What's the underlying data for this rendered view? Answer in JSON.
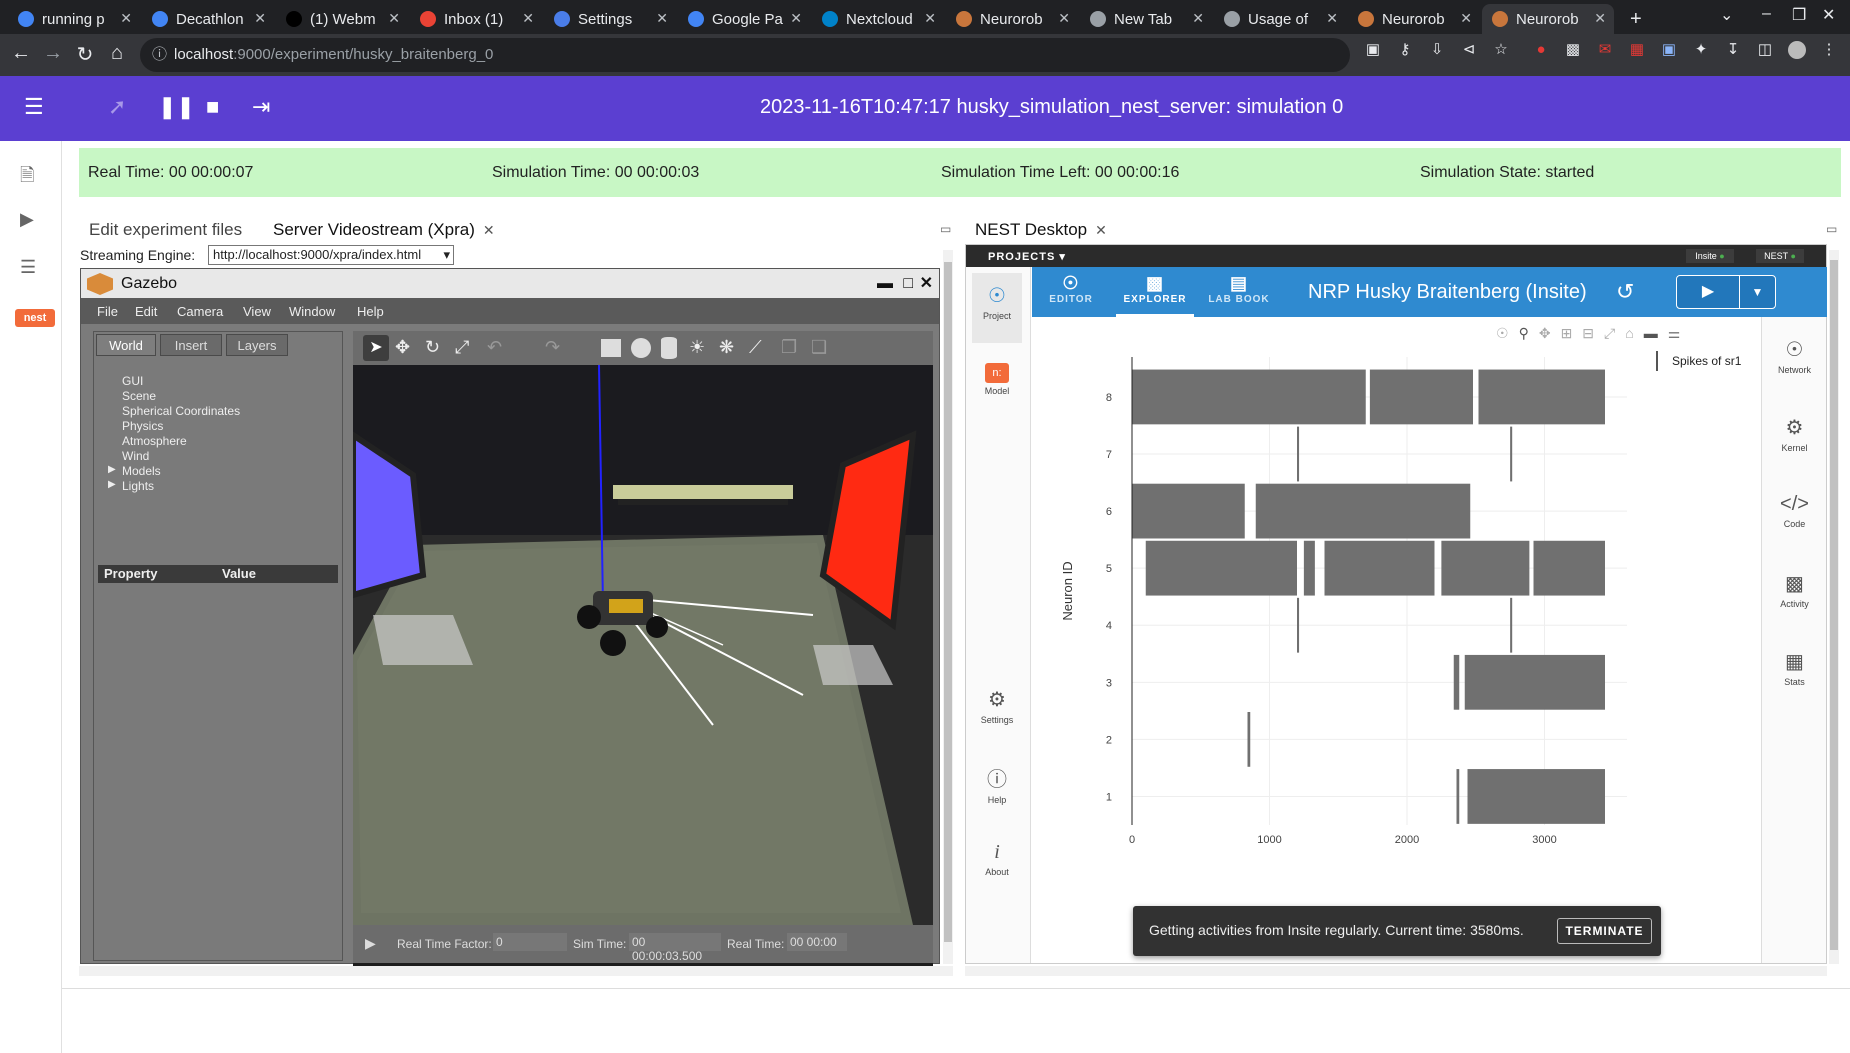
{
  "browser": {
    "tabs": [
      {
        "title": "running p",
        "color": "#4285f4"
      },
      {
        "title": "Decathlon",
        "color": "#4285f4"
      },
      {
        "title": "(1) Webm",
        "color": "#000000"
      },
      {
        "title": "Inbox (1)",
        "color": "#ea4335"
      },
      {
        "title": "Settings",
        "color": "#4a7de8"
      },
      {
        "title": "Google Pa",
        "color": "#4285f4"
      },
      {
        "title": "Nextcloud",
        "color": "#0082c9"
      },
      {
        "title": "Neurorob",
        "color": "#c8763c"
      },
      {
        "title": "New Tab",
        "color": "#9aa0a6"
      },
      {
        "title": "Usage of",
        "color": "#9aa0a6"
      },
      {
        "title": "Neurorob",
        "color": "#c8763c"
      },
      {
        "title": "Neurorob",
        "color": "#c8763c"
      }
    ],
    "url_host": "localhost",
    "url_rest": ":9000/experiment/husky_braitenberg_0"
  },
  "header": {
    "title": "2023-11-16T10:47:17 husky_simulation_nest_server: simulation 0"
  },
  "status": {
    "real_time": "Real Time: 00 00:00:07",
    "sim_time": "Simulation Time: 00 00:00:03",
    "time_left": "Simulation Time Left: 00 00:00:16",
    "state": "Simulation State: started"
  },
  "left_tabs": {
    "edit": "Edit experiment files",
    "stream": "Server Videostream (Xpra)"
  },
  "streaming": {
    "label": "Streaming Engine:",
    "value": "http://localhost:9000/xpra/index.html"
  },
  "gazebo": {
    "title": "Gazebo",
    "menu": [
      "File",
      "Edit",
      "Camera",
      "View",
      "Window",
      "Help"
    ],
    "panel_tabs": [
      "World",
      "Insert",
      "Layers"
    ],
    "tree": [
      "GUI",
      "Scene",
      "Spherical Coordinates",
      "Physics",
      "Atmosphere",
      "Wind",
      "Models",
      "Lights"
    ],
    "prop_header": "Property",
    "value_header": "Value",
    "rtf_label": "Real Time Factor:",
    "rtf_value": "0",
    "simtime_label": "Sim Time:",
    "simtime_value": "00 00:00:03.500",
    "realtime_label": "Real Time:",
    "realtime_value": "00 00:00"
  },
  "nest": {
    "tab": "NEST Desktop",
    "projects": "PROJECTS",
    "badge_insite": "Insite",
    "badge_nest": "NEST",
    "title": "NRP Husky Braitenberg (Insite)",
    "nav": [
      "EDITOR",
      "EXPLORER",
      "LAB BOOK"
    ],
    "side": [
      "Project",
      "Model",
      "Settings",
      "Help",
      "About"
    ],
    "right": [
      "Network",
      "Kernel",
      "Code",
      "Activity",
      "Stats"
    ],
    "toast": "Getting activities from Insite regularly. Current time: 3580ms.",
    "terminate": "TERMINATE"
  },
  "chart_data": {
    "type": "scatter",
    "title": "",
    "xlabel": "",
    "ylabel": "Neuron ID",
    "xlim": [
      0,
      3600
    ],
    "ylim": [
      0.5,
      8.7
    ],
    "x_ticks": [
      0,
      1000,
      2000,
      3000
    ],
    "y_ticks": [
      1,
      2,
      3,
      4,
      5,
      6,
      7,
      8
    ],
    "legend": "top-right",
    "series": [
      {
        "name": "Spikes of sr1",
        "color": "#707070",
        "rows": [
          {
            "id": 8,
            "ranges": [
              [
                0,
                1700
              ],
              [
                1730,
                2480
              ],
              [
                2520,
                3440
              ]
            ]
          },
          {
            "id": 7,
            "ranges": [
              [
                1200,
                1215
              ],
              [
                2750,
                2765
              ]
            ]
          },
          {
            "id": 6,
            "ranges": [
              [
                0,
                820
              ],
              [
                900,
                2460
              ]
            ]
          },
          {
            "id": 5,
            "ranges": [
              [
                100,
                1200
              ],
              [
                1250,
                1330
              ],
              [
                1400,
                2200
              ],
              [
                2250,
                2890
              ],
              [
                2920,
                3440
              ]
            ]
          },
          {
            "id": 4,
            "ranges": [
              [
                1200,
                1215
              ],
              [
                2750,
                2765
              ]
            ]
          },
          {
            "id": 3,
            "ranges": [
              [
                2340,
                2380
              ],
              [
                2420,
                3440
              ]
            ]
          },
          {
            "id": 2,
            "ranges": [
              [
                840,
                860
              ]
            ]
          },
          {
            "id": 1,
            "ranges": [
              [
                2360,
                2380
              ],
              [
                2440,
                3440
              ]
            ]
          }
        ]
      }
    ]
  }
}
